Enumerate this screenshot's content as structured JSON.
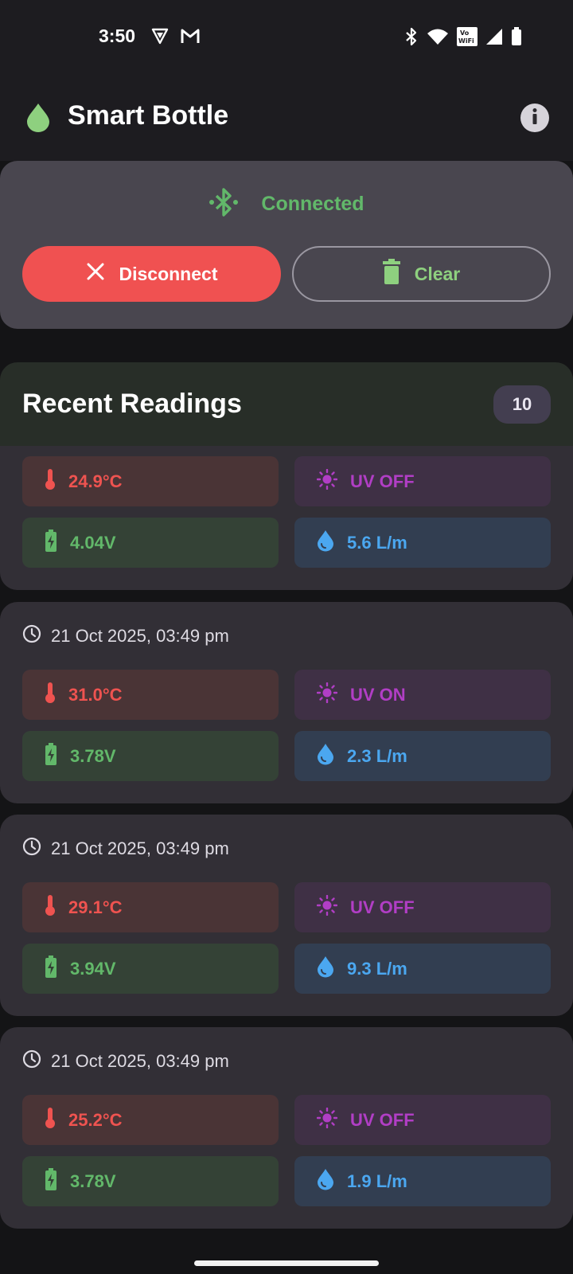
{
  "status_bar": {
    "time": "3:50"
  },
  "app_bar": {
    "title": "Smart Bottle"
  },
  "connection": {
    "status": "Connected",
    "disconnect_label": "Disconnect",
    "clear_label": "Clear"
  },
  "recent": {
    "title": "Recent Readings",
    "count": "10"
  },
  "readings": [
    {
      "timestamp": "",
      "temperature": "24.9°C",
      "uv": "UV OFF",
      "voltage": "4.04V",
      "flow": "5.6 L/m"
    },
    {
      "timestamp": "21 Oct 2025, 03:49 pm",
      "temperature": "31.0°C",
      "uv": "UV ON",
      "voltage": "3.78V",
      "flow": "2.3 L/m"
    },
    {
      "timestamp": "21 Oct 2025, 03:49 pm",
      "temperature": "29.1°C",
      "uv": "UV OFF",
      "voltage": "3.94V",
      "flow": "9.3 L/m"
    },
    {
      "timestamp": "21 Oct 2025, 03:49 pm",
      "temperature": "25.2°C",
      "uv": "UV OFF",
      "voltage": "3.78V",
      "flow": "1.9 L/m"
    }
  ],
  "colors": {
    "connected_green": "#62b86a",
    "disconnect_red": "#f05151",
    "temp_red": "#ef5350",
    "uv_purple": "#b13ec5",
    "flow_blue": "#4ba7f0"
  },
  "icons": {
    "status_left": [
      "vpn-icon",
      "gmail-icon"
    ],
    "status_right": [
      "bluetooth-icon",
      "wifi-icon",
      "vowifi-icon",
      "signal-icon",
      "battery-icon"
    ],
    "logo": "water-drop-icon",
    "info": "info-icon",
    "connection": "bluetooth-connected-icon",
    "disconnect": "close-icon",
    "clear": "trash-icon",
    "timestamp": "clock-icon",
    "temperature": "thermometer-icon",
    "uv": "sun-icon",
    "voltage": "battery-charging-icon",
    "flow": "water-drop-icon"
  }
}
